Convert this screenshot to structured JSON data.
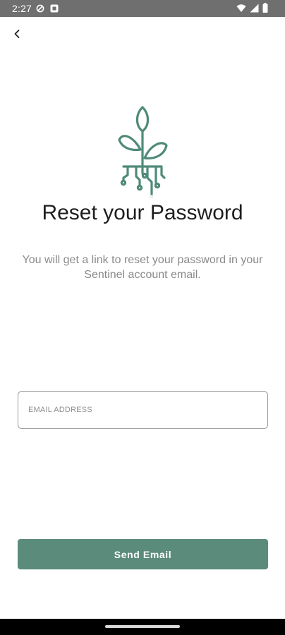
{
  "status_bar": {
    "time": "2:27",
    "icons_left": [
      "do-not-disturb-icon",
      "notification-icon"
    ],
    "icons_right": [
      "wifi-icon",
      "signal-icon",
      "battery-icon"
    ]
  },
  "header": {
    "back_icon": "chevron-left-icon"
  },
  "logo": {
    "icon": "plant-circuit-logo-icon",
    "color": "#4f8a79"
  },
  "content": {
    "title": "Reset your Password",
    "description": "You will get a link to reset your password in your Sentinel account email."
  },
  "form": {
    "email": {
      "placeholder": "EMAIL ADDRESS",
      "value": ""
    },
    "submit_label": "Send Email"
  },
  "colors": {
    "accent": "#5b8c7b",
    "status_bar": "#6f6f6f"
  }
}
